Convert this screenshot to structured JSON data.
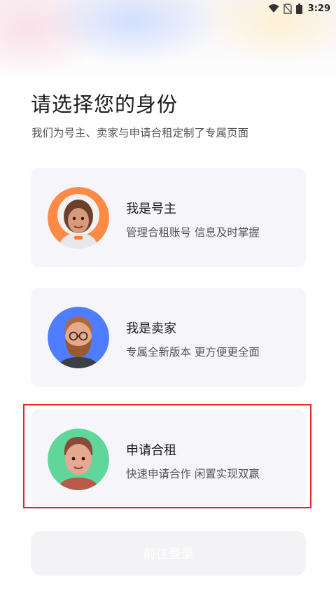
{
  "status_bar": {
    "time": "3:29"
  },
  "header": {
    "title": "请选择您的身份",
    "subtitle": "我们为号主、卖家与申请合租定制了专属页面"
  },
  "roles": [
    {
      "name": "我是号主",
      "desc": "管理合租账号 信息及时掌握",
      "avatar_bg": "#ff8a45"
    },
    {
      "name": "我是卖家",
      "desc": "专属全新版本 更方便更全面",
      "avatar_bg": "#4f7dff"
    },
    {
      "name": "申请合租",
      "desc": "快速申请合作 闲置实现双赢",
      "avatar_bg": "#5fd69a"
    }
  ],
  "login_button": {
    "label": "前往登录"
  },
  "colors": {
    "card_bg": "#f6f6fa",
    "highlight": "#e32626",
    "button_bg": "#f3f3f5"
  }
}
